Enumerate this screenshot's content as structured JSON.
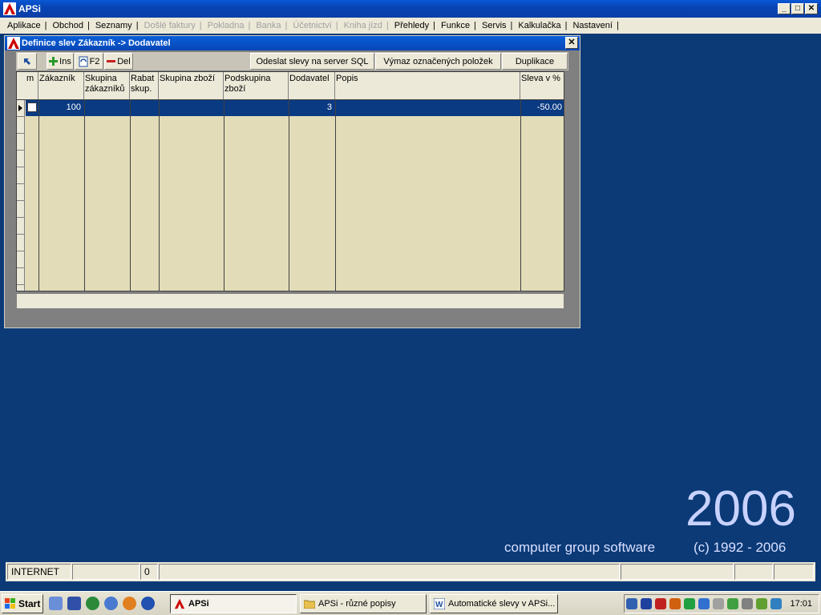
{
  "app": {
    "title": "APSi"
  },
  "menu": [
    {
      "label": "Aplikace",
      "enabled": true
    },
    {
      "label": "Obchod",
      "enabled": true
    },
    {
      "label": "Seznamy",
      "enabled": true
    },
    {
      "label": "Došlé faktury",
      "enabled": false
    },
    {
      "label": "Pokladna",
      "enabled": false
    },
    {
      "label": "Banka",
      "enabled": false
    },
    {
      "label": "Účetnictví",
      "enabled": false
    },
    {
      "label": "Kniha jízd",
      "enabled": false
    },
    {
      "label": "Přehledy",
      "enabled": true
    },
    {
      "label": "Funkce",
      "enabled": true
    },
    {
      "label": "Servis",
      "enabled": true
    },
    {
      "label": "Kalkulačka",
      "enabled": true
    },
    {
      "label": "Nastavení",
      "enabled": true
    }
  ],
  "dialog": {
    "title": "Definice slev Zákazník -> Dodavatel",
    "close_label": "✕",
    "toolbar": {
      "ins_label": "Ins",
      "f2_label": "F2",
      "del_label": "Del",
      "send_label": "Odeslat slevy na server SQL",
      "extract_label": "Výmaz označených položek",
      "duplicate_label": "Duplikace"
    },
    "columns": [
      "m",
      "Zákazník",
      "Skupina zákazníků",
      "Rabat skup.",
      "Skupina zboží",
      "Podskupina zboží",
      "Dodavatel",
      "Popis",
      "Sleva v %"
    ],
    "rows": [
      {
        "zakaznik": "100",
        "dodavatel": "3",
        "sleva": "-50.00"
      }
    ]
  },
  "splash": {
    "year": "2006",
    "company": "computer group software",
    "copyright": "(c) 1992 - 2006"
  },
  "status": {
    "connection": "INTERNET",
    "count": "0"
  },
  "taskbar": {
    "start_label": "Start",
    "items": [
      "APSi",
      "APSi - různé popisy",
      "Automatické slevy v APSi..."
    ],
    "clock": "17:01"
  },
  "colors": {
    "desktop": "#0b3a77",
    "selection": "#0a3a82",
    "grid_bg": "#e2ddb8"
  }
}
